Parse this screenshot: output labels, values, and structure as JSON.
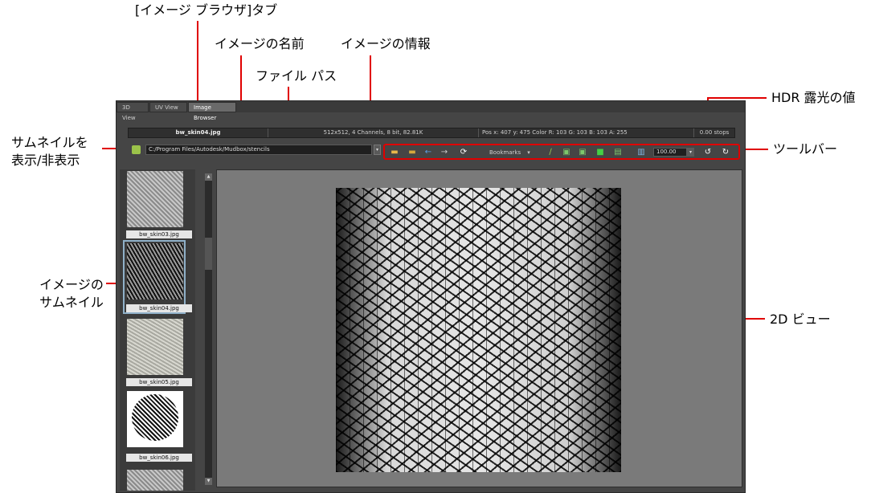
{
  "callouts": {
    "image_browser_tab": "[イメージ ブラウザ]タブ",
    "image_name": "イメージの名前",
    "image_info": "イメージの情報",
    "file_path": "ファイル パス",
    "hdr_exposure": "HDR 露光の値",
    "show_hide_thumbnails": "サムネイルを\n表示/非表示",
    "toolbar": "ツールバー",
    "image_thumbnails": "イメージの\nサムネイル",
    "view_2d": "2D ビュー"
  },
  "app": {
    "tabs": [
      {
        "label": "3D View",
        "active": false
      },
      {
        "label": "UV View",
        "active": false
      },
      {
        "label": "Image Browser",
        "active": true
      }
    ],
    "infobar": {
      "name": "bw_skin04.jpg",
      "info": "512x512, 4 Channels, 8 bit,  82.81K",
      "pos": "Pos x: 407 y: 475 Color R: 103 G: 103 B: 103 A: 255",
      "stops": "0.00 stops"
    },
    "path": "C:/Program Files/Autodesk/Mudbox/stencils",
    "toolbar": {
      "bookmarks_label": "Bookmarks",
      "zoom_value": "100.00"
    },
    "thumbnails": [
      "bw_skin03.jpg",
      "bw_skin04.jpg",
      "bw_skin05.jpg",
      "bw_skin06.jpg"
    ]
  },
  "colors": {
    "callout_line": "#e00000",
    "toolbar_highlight": "#e00000",
    "app_bg": "#454545"
  }
}
